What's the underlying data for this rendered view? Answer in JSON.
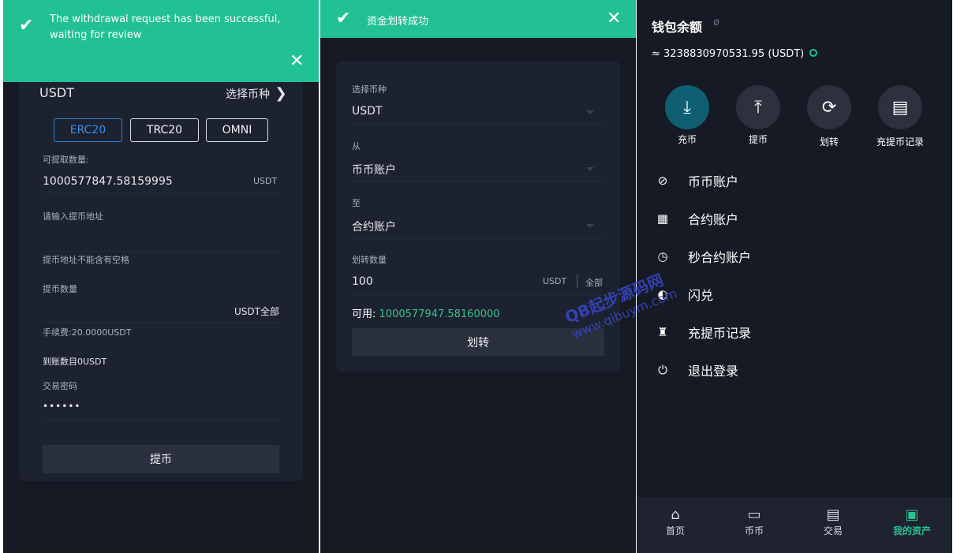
{
  "panel_withdraw": {
    "toast_message": "The withdrawal request has been successful, waiting for review",
    "coin": "USDT",
    "select_coin_label": "选择币种",
    "networks": [
      "ERC20",
      "TRC20",
      "OMNI"
    ],
    "available_label": "可提取数量:",
    "available_value": "1000577847.58159995",
    "available_unit": "USDT",
    "address_placeholder": "请输入提币地址",
    "address_note": "提币地址不能含有空格",
    "amount_label": "提币数量",
    "amount_unit_all": "USDT全部",
    "fee_text": "手续费:20.0000USDT",
    "arrival_text": "到账数目0USDT",
    "password_label": "交易密码",
    "password_value": "••••••",
    "submit_label": "提币"
  },
  "panel_transfer": {
    "toast_message": "资金划转成功",
    "coin_label": "选择币种",
    "coin_value": "USDT",
    "from_label": "从",
    "from_value": "币币账户",
    "to_label": "至",
    "to_value": "合约账户",
    "amount_label": "划转数量",
    "amount_value": "100",
    "amount_unit": "USDT",
    "all_label": "全部",
    "available_label": "可用:",
    "available_value": "1000577947.58160000",
    "submit_label": "划转"
  },
  "panel_wallet": {
    "title": "钱包余额",
    "balance": "≈ 3238830970531.95 (USDT)",
    "actions": [
      {
        "label": "充币",
        "icon": "download-icon"
      },
      {
        "label": "提币",
        "icon": "upload-icon"
      },
      {
        "label": "划转",
        "icon": "refresh-icon"
      },
      {
        "label": "充提币记录",
        "icon": "document-icon"
      }
    ],
    "menu": [
      {
        "label": "币币账户",
        "icon": "coin-icon"
      },
      {
        "label": "合约账户",
        "icon": "contract-icon"
      },
      {
        "label": "秒合约账户",
        "icon": "clock-icon"
      },
      {
        "label": "闪兑",
        "icon": "flash-exchange-icon"
      },
      {
        "label": "充提币记录",
        "icon": "money-bag-icon"
      },
      {
        "label": "退出登录",
        "icon": "power-icon"
      }
    ],
    "tabs": [
      {
        "label": "首页",
        "icon": "home-icon"
      },
      {
        "label": "币币",
        "icon": "folder-icon"
      },
      {
        "label": "交易",
        "icon": "trade-icon"
      },
      {
        "label": "我的资产",
        "icon": "wallet-icon"
      }
    ]
  },
  "watermark": {
    "line1": "QB起步源码网",
    "line2": "www.qibuym.com"
  },
  "colors": {
    "accent_green": "#22c193",
    "panel_bg": "#161a24",
    "card_bg": "#1d2230",
    "active_network": "#3a8fe6",
    "available_green": "#3cc08a"
  }
}
